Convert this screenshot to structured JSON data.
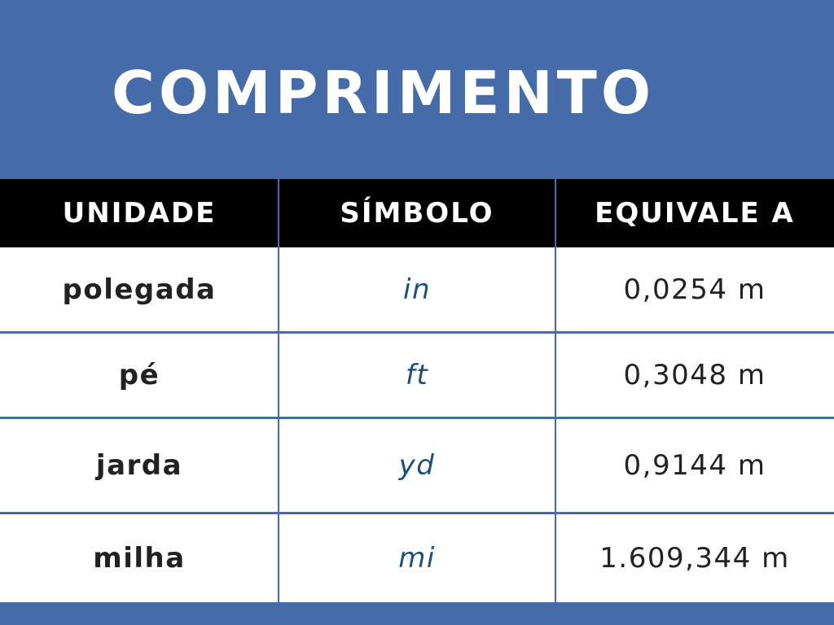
{
  "title": "COMPRIMENTO",
  "table": {
    "headers": [
      "UNIDADE",
      "SÍMBOLO",
      "EQUIVALE A"
    ],
    "rows": [
      {
        "unit": "polegada",
        "symbol": "in",
        "equivalent": "0,0254 m"
      },
      {
        "unit": "pé",
        "symbol": "ft",
        "equivalent": "0,3048 m"
      },
      {
        "unit": "jarda",
        "symbol": "yd",
        "equivalent": "0,9144 m"
      },
      {
        "unit": "milha",
        "symbol": "mi",
        "equivalent": "1.609,344 m"
      }
    ]
  },
  "colors": {
    "brand_blue": "#456ca8",
    "header_black": "#000000",
    "symbol_color": "#1f4f78",
    "text_dark": "#222222"
  }
}
